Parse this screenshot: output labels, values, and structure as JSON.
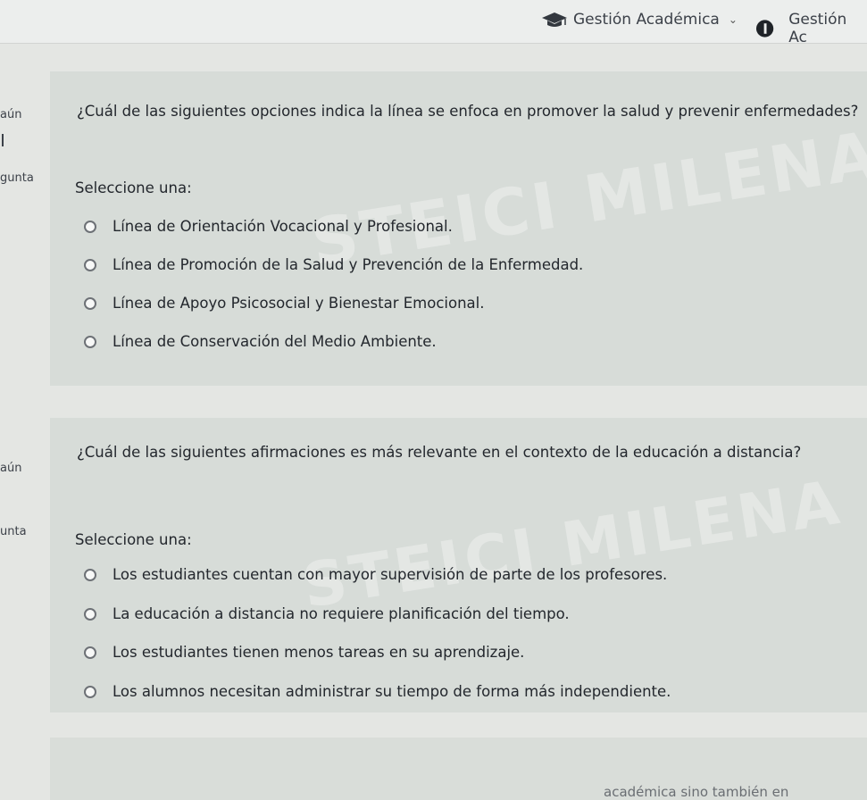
{
  "navbar": {
    "academic_label": "Gestión Académica",
    "gestion_label": "Gestión Ac"
  },
  "sidebar": {
    "q1_status": "aún",
    "q1_pregunta": "gunta",
    "q2_status": "aún",
    "q2_pregunta": "unta"
  },
  "question1": {
    "text": "¿Cuál de las siguientes opciones indica la línea se enfoca en promover la salud y prevenir enfermedades?",
    "select_label": "Seleccione una:",
    "options": [
      "Línea de Orientación Vocacional y Profesional.",
      "Línea de Promoción de la Salud y Prevención de la Enfermedad.",
      "Línea de Apoyo Psicosocial y Bienestar Emocional.",
      "Línea de Conservación del Medio Ambiente."
    ]
  },
  "question2": {
    "text": "¿Cuál de las siguientes afirmaciones es más relevante en el contexto de la educación a distancia?",
    "select_label": "Seleccione una:",
    "options": [
      "Los estudiantes cuentan con mayor supervisión de parte de los profesores.",
      "La educación a distancia no requiere planificación del tiempo.",
      "Los estudiantes tienen menos tareas en su aprendizaje.",
      "Los alumnos necesitan administrar su tiempo de forma más independiente."
    ]
  },
  "watermark": "STEICI MILENA M",
  "footer_fragment": "académica sino también en",
  "icons": [
    "graduation-cap-icon",
    "chevron-down-icon",
    "circle-icon"
  ]
}
